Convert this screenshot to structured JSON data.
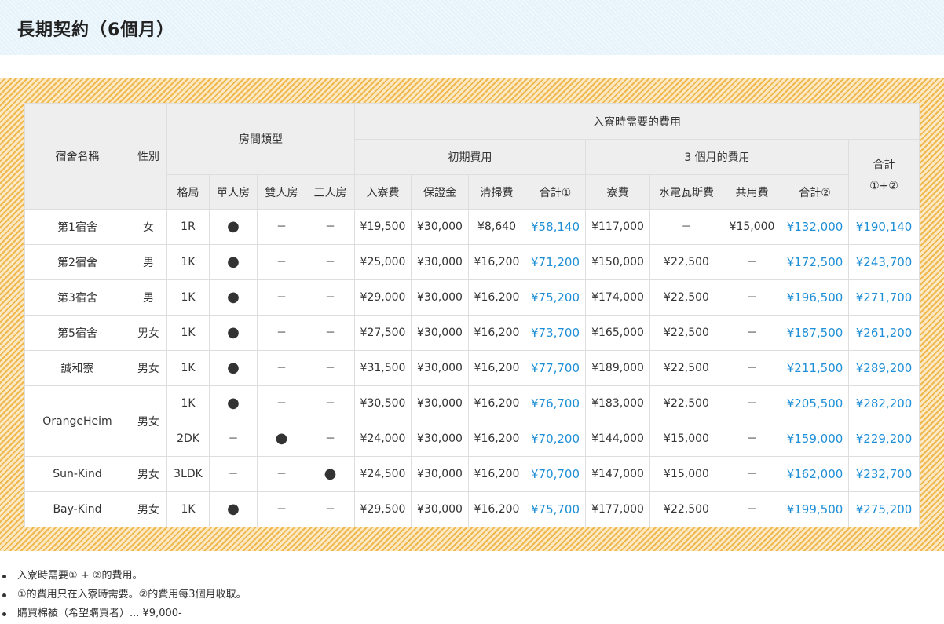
{
  "page": {
    "title": "長期契約（6個月）"
  },
  "table": {
    "headers": {
      "dorm_name": "宿舍名稱",
      "gender": "性別",
      "room_type": "房間類型",
      "movein_fees": "入寮時需要的費用",
      "initial_fees": "初期費用",
      "three_month_fees": "3 個月的費用",
      "grand_total": "合計",
      "grand_total_formula": "①+②",
      "layout": "格局",
      "single": "單人房",
      "double": "雙人房",
      "triple": "三人房",
      "entry_fee": "入寮費",
      "deposit": "保證金",
      "cleaning": "清掃費",
      "subtotal1": "合計①",
      "rent": "寮費",
      "utilities": "水電瓦斯費",
      "common": "共用費",
      "subtotal2": "合計②"
    },
    "rows": [
      {
        "name": "第1宿舍",
        "gender": "女",
        "layout": "1R",
        "single": "●",
        "double": "－",
        "triple": "－",
        "entry": "¥19,500",
        "deposit": "¥30,000",
        "cleaning": "¥8,640",
        "sub1": "¥58,140",
        "rent": "¥117,000",
        "utilities": "－",
        "common": "¥15,000",
        "sub2": "¥132,000",
        "total": "¥190,140"
      },
      {
        "name": "第2宿舍",
        "gender": "男",
        "layout": "1K",
        "single": "●",
        "double": "－",
        "triple": "－",
        "entry": "¥25,000",
        "deposit": "¥30,000",
        "cleaning": "¥16,200",
        "sub1": "¥71,200",
        "rent": "¥150,000",
        "utilities": "¥22,500",
        "common": "－",
        "sub2": "¥172,500",
        "total": "¥243,700"
      },
      {
        "name": "第3宿舍",
        "gender": "男",
        "layout": "1K",
        "single": "●",
        "double": "－",
        "triple": "－",
        "entry": "¥29,000",
        "deposit": "¥30,000",
        "cleaning": "¥16,200",
        "sub1": "¥75,200",
        "rent": "¥174,000",
        "utilities": "¥22,500",
        "common": "－",
        "sub2": "¥196,500",
        "total": "¥271,700"
      },
      {
        "name": "第5宿舍",
        "gender": "男女",
        "layout": "1K",
        "single": "●",
        "double": "－",
        "triple": "－",
        "entry": "¥27,500",
        "deposit": "¥30,000",
        "cleaning": "¥16,200",
        "sub1": "¥73,700",
        "rent": "¥165,000",
        "utilities": "¥22,500",
        "common": "－",
        "sub2": "¥187,500",
        "total": "¥261,200"
      },
      {
        "name": "誠和寮",
        "gender": "男女",
        "layout": "1K",
        "single": "●",
        "double": "－",
        "triple": "－",
        "entry": "¥31,500",
        "deposit": "¥30,000",
        "cleaning": "¥16,200",
        "sub1": "¥77,700",
        "rent": "¥189,000",
        "utilities": "¥22,500",
        "common": "－",
        "sub2": "¥211,500",
        "total": "¥289,200"
      },
      {
        "name": "OrangeHeim",
        "gender": "男女",
        "layout": "1K",
        "single": "●",
        "double": "－",
        "triple": "－",
        "entry": "¥30,500",
        "deposit": "¥30,000",
        "cleaning": "¥16,200",
        "sub1": "¥76,700",
        "rent": "¥183,000",
        "utilities": "¥22,500",
        "common": "－",
        "sub2": "¥205,500",
        "total": "¥282,200"
      },
      {
        "layout": "2DK",
        "single": "－",
        "double": "●",
        "triple": "－",
        "entry": "¥24,000",
        "deposit": "¥30,000",
        "cleaning": "¥16,200",
        "sub1": "¥70,200",
        "rent": "¥144,000",
        "utilities": "¥15,000",
        "common": "－",
        "sub2": "¥159,000",
        "total": "¥229,200"
      },
      {
        "name": "Sun-Kind",
        "gender": "男女",
        "layout": "3LDK",
        "single": "－",
        "double": "－",
        "triple": "●",
        "entry": "¥24,500",
        "deposit": "¥30,000",
        "cleaning": "¥16,200",
        "sub1": "¥70,700",
        "rent": "¥147,000",
        "utilities": "¥15,000",
        "common": "－",
        "sub2": "¥162,000",
        "total": "¥232,700"
      },
      {
        "name": "Bay-Kind",
        "gender": "男女",
        "layout": "1K",
        "single": "●",
        "double": "－",
        "triple": "－",
        "entry": "¥29,500",
        "deposit": "¥30,000",
        "cleaning": "¥16,200",
        "sub1": "¥75,700",
        "rent": "¥177,000",
        "utilities": "¥22,500",
        "common": "－",
        "sub2": "¥199,500",
        "total": "¥275,200"
      }
    ]
  },
  "notes": [
    "入寮時需要① + ②的費用。",
    "①的費用只在入寮時需要。②的費用每3個月收取。",
    "購買棉被（希望購買者）... ¥9,000-"
  ],
  "colors": {
    "total_text": "#1e8fd6",
    "frame_stripe": "#f0b84c",
    "header_bg": "#e6f3fb"
  }
}
